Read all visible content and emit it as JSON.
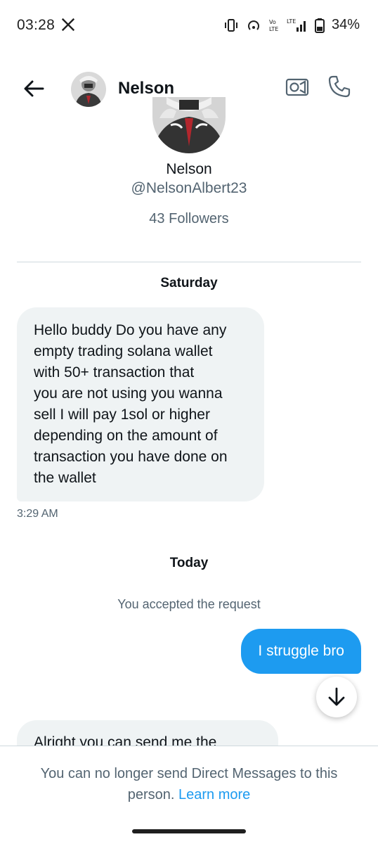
{
  "status_bar": {
    "time": "03:28",
    "battery_percent": "34%",
    "icons": [
      "x-logo-icon",
      "vibrate-icon",
      "hotspot-icon",
      "volte-icon",
      "lte-signal-icon",
      "battery-icon"
    ]
  },
  "header": {
    "contact_name": "Nelson"
  },
  "profile": {
    "name": "Nelson",
    "handle": "@NelsonAlbert23",
    "followers": "43 Followers"
  },
  "conversation": {
    "day1": "Saturday",
    "msg1_lines": [
      "Hello buddy Do you have any",
      "empty trading solana wallet",
      "with 50+ transaction that",
      "you are not using you wanna",
      "sell I will pay 1sol or higher",
      "depending on the amount of",
      "transaction you have done on",
      "the wallet"
    ],
    "msg1_time": "3:29 AM",
    "day2": "Today",
    "system_message": "You accepted the request",
    "sent_message": "I struggle bro",
    "partial_message": "Alright you can send me the"
  },
  "footer": {
    "notice": "You can no longer send Direct Messages to this person.",
    "learn_more": "Learn more"
  },
  "colors": {
    "accent": "#1d9bf0",
    "bubble_in": "#eff3f4",
    "secondary_text": "#536471"
  }
}
